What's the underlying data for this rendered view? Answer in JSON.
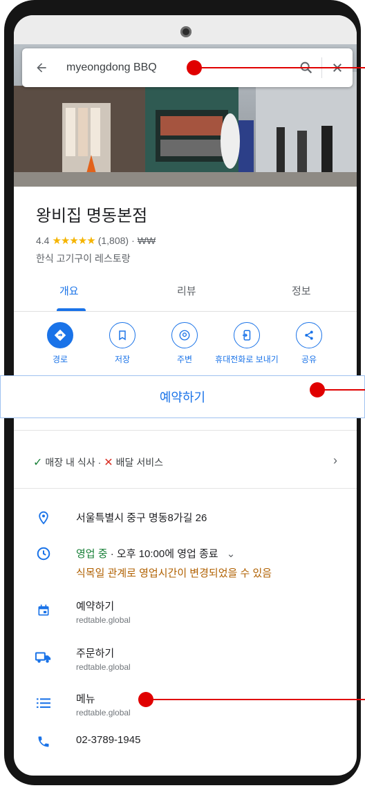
{
  "search": {
    "query": "myeongdong BBQ"
  },
  "place": {
    "name": "왕비집 명동본점",
    "rating": "4.4",
    "stars": "★★★★★",
    "reviews": "(1,808)",
    "price": "₩₩",
    "category": "한식 고기구이 레스토랑"
  },
  "tabs": [
    {
      "label": "개요"
    },
    {
      "label": "리뷰"
    },
    {
      "label": "정보"
    }
  ],
  "actions": [
    {
      "label": "경로",
      "icon": "directions-icon"
    },
    {
      "label": "저장",
      "icon": "bookmark-icon"
    },
    {
      "label": "주변",
      "icon": "nearby-icon"
    },
    {
      "label": "휴대전화로 보내기",
      "icon": "send-to-phone-icon"
    },
    {
      "label": "공유",
      "icon": "share-icon"
    }
  ],
  "reserve_button": {
    "label": "예약하기"
  },
  "services": {
    "dine_in": "매장 내 식사",
    "sep": "·",
    "delivery": "배달 서비스"
  },
  "info": {
    "address": "서울특별시 중구 명동8가길 26",
    "hours_open": "영업 중",
    "hours_sep": "·",
    "hours_close": "오후 10:00에 영업 종료",
    "hours_notice": "식목일 관계로 영업시간이 변경되었을 수 있음",
    "reserve": {
      "label": "예약하기",
      "site": "redtable.global"
    },
    "order": {
      "label": "주문하기",
      "site": "redtable.global"
    },
    "menu": {
      "label": "메뉴",
      "site": "redtable.global"
    },
    "phone": "02-3789-1945"
  },
  "colors": {
    "accent": "#1a73e8",
    "open": "#188038",
    "warning": "#b06000",
    "annotation": "#e00000"
  }
}
